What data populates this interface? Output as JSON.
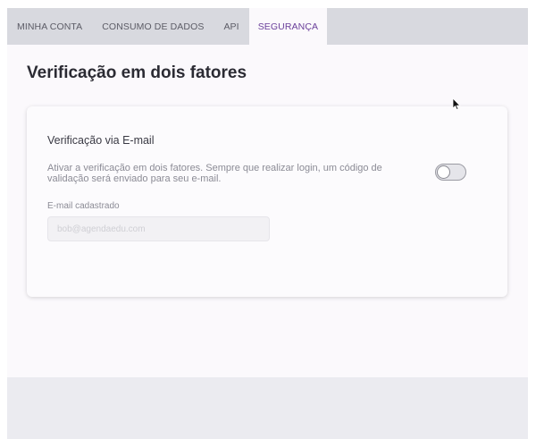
{
  "tabs": [
    {
      "label": "MINHA CONTA",
      "active": false
    },
    {
      "label": "CONSUMO DE DADOS",
      "active": false
    },
    {
      "label": "API",
      "active": false
    },
    {
      "label": "SEGURANÇA",
      "active": true
    }
  ],
  "page": {
    "title": "Verificação em dois fatores"
  },
  "card": {
    "title": "Verificação via E-mail",
    "description": "Ativar a verificação em dois fatores. Sempre que realizar login, um código de validação será enviado para seu e-mail.",
    "toggle_enabled": false,
    "email_label": "E-mail cadastrado",
    "email_value": "",
    "email_placeholder": "bob@agendaedu.com"
  },
  "colors": {
    "accent": "#6a3f9a",
    "tabbar": "#d8d9df",
    "background": "#fbf9fc"
  },
  "icons": {
    "cursor": "mouse-pointer-icon"
  }
}
